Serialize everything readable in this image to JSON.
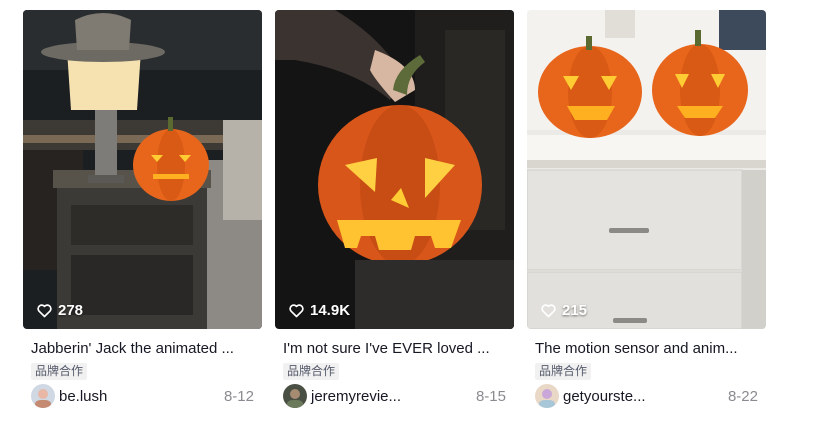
{
  "videos": [
    {
      "likes": "278",
      "description": "Jabberin' Jack the animated ...",
      "badge": "品牌合作",
      "username": "be.lush",
      "date": "8-12",
      "avatar_color": "#e8b7a6"
    },
    {
      "likes": "14.9K",
      "description": "I'm not sure I've EVER loved ...",
      "badge": "品牌合作",
      "username": "jeremyrevie...",
      "date": "8-15",
      "avatar_color": "#6b7a5a"
    },
    {
      "likes": "215",
      "description": "The motion sensor and anim...",
      "badge": "品牌合作",
      "username": "getyourste...",
      "date": "8-22",
      "avatar_color": "#c9a7d8"
    }
  ],
  "icons": {
    "like": "heart-icon"
  },
  "colors": {
    "text": "#161823",
    "muted": "#8a8b91",
    "badge_bg": "#f1f1f2",
    "pumpkin": "#e8661c",
    "glow": "#ffcc33"
  }
}
